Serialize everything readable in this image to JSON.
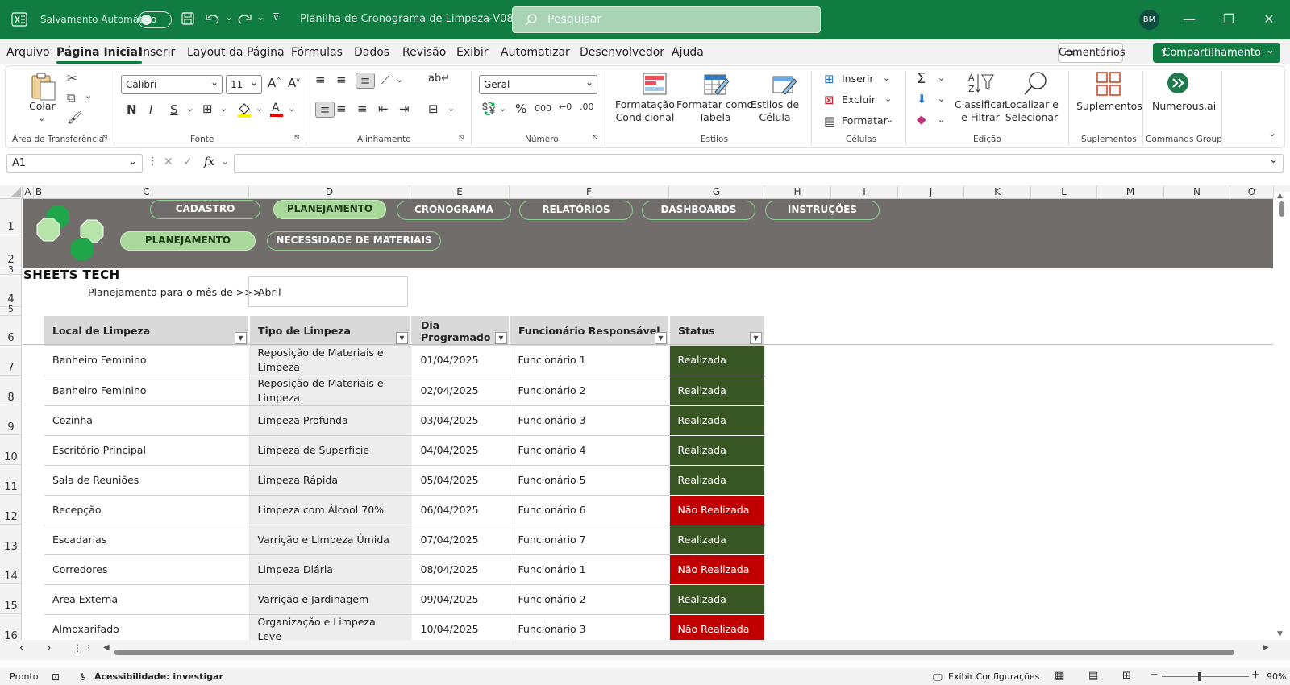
{
  "titlebar": {
    "autosave_label": "Salvamento Automático",
    "doc_title": "Planilha de Cronograma de Limpeza V08",
    "search_placeholder": "Pesquisar",
    "user_initials": "BM"
  },
  "menu": [
    "Arquivo",
    "Página Inicial",
    "Inserir",
    "Layout da Página",
    "Fórmulas",
    "Dados",
    "Revisão",
    "Exibir",
    "Automatizar",
    "Desenvolvedor",
    "Ajuda"
  ],
  "menu_active": "Página Inicial",
  "actions": {
    "comments": "Comentários",
    "share": "Compartilhamento"
  },
  "ribbon": {
    "clipboard": {
      "paste": "Colar",
      "label": "Área de Transferência"
    },
    "font": {
      "name": "Calibri",
      "size": "11",
      "label": "Fonte"
    },
    "alignment": {
      "label": "Alinhamento"
    },
    "number": {
      "format": "Geral",
      "label": "Número"
    },
    "styles": {
      "cond_format": "Formatação\nCondicional",
      "format_table": "Formatar como\nTabela",
      "cell_styles": "Estilos de\nCélula",
      "label": "Estilos"
    },
    "cells": {
      "insert": "Inserir",
      "delete": "Excluir",
      "format": "Formatar",
      "label": "Células"
    },
    "editing": {
      "sort_filter": "Classificar\ne Filtrar",
      "find_select": "Localizar e\nSelecionar",
      "label": "Edição"
    },
    "addins": {
      "btn": "Suplementos",
      "label": "Suplementos"
    },
    "commands": {
      "btn": "Numerous.ai",
      "label": "Commands Group"
    }
  },
  "formula_bar": {
    "name_box": "A1",
    "formula": ""
  },
  "columns": [
    "A",
    "B",
    "C",
    "D",
    "E",
    "F",
    "G",
    "H",
    "I",
    "J",
    "K",
    "L",
    "M",
    "N",
    "O"
  ],
  "rows": [
    "1",
    "2",
    "3",
    "4",
    "5",
    "6",
    "7",
    "8",
    "9",
    "10",
    "11",
    "12",
    "13",
    "14",
    "15",
    "16"
  ],
  "sheet": {
    "nav_row1": [
      "CADASTRO",
      "PLANEJAMENTO",
      "CRONOGRAMA",
      "RELATÓRIOS",
      "DASHBOARDS",
      "INSTRUÇÕES"
    ],
    "nav_row2": [
      "PLANEJAMENTO",
      "NECESSIDADE DE MATERIAIS"
    ],
    "brand": "SHEETS TECH",
    "plan_label": "Planejamento para o mês de >>>",
    "plan_month": "Abril",
    "table_headers": [
      "Local de Limpeza",
      "Tipo de Limpeza",
      "Dia Programado",
      "Funcionário Responsável",
      "Status"
    ],
    "table_rows": [
      [
        "Banheiro Feminino",
        "Reposição de Materiais e Limpeza",
        "01/04/2025",
        "Funcionário 1",
        "Realizada"
      ],
      [
        "Banheiro Feminino",
        "Reposição de Materiais e Limpeza",
        "02/04/2025",
        "Funcionário 2",
        "Realizada"
      ],
      [
        "Cozinha",
        "Limpeza Profunda",
        "03/04/2025",
        "Funcionário 3",
        "Realizada"
      ],
      [
        "Escritório Principal",
        "Limpeza de Superfície",
        "04/04/2025",
        "Funcionário 4",
        "Realizada"
      ],
      [
        "Sala de Reuniões",
        "Limpeza Rápida",
        "05/04/2025",
        "Funcionário 5",
        "Realizada"
      ],
      [
        "Recepção",
        "Limpeza com Álcool 70%",
        "06/04/2025",
        "Funcionário 6",
        "Não Realizada"
      ],
      [
        "Escadarias",
        "Varrição e Limpeza Úmida",
        "07/04/2025",
        "Funcionário 7",
        "Realizada"
      ],
      [
        "Corredores",
        "Limpeza Diária",
        "08/04/2025",
        "Funcionário 1",
        "Não Realizada"
      ],
      [
        "Área Externa",
        "Varrição e Jardinagem",
        "09/04/2025",
        "Funcionário 2",
        "Realizada"
      ],
      [
        "Almoxarifado",
        "Organização e Limpeza Leve",
        "10/04/2025",
        "Funcionário 3",
        "Não Realizada"
      ]
    ]
  },
  "status_colors": {
    "Realizada": "#375623",
    "Não Realizada": "#c00000"
  },
  "statusbar": {
    "ready": "Pronto",
    "accessibility": "Acessibilidade: investigar",
    "display_settings": "Exibir Configurações",
    "zoom": "90%"
  }
}
